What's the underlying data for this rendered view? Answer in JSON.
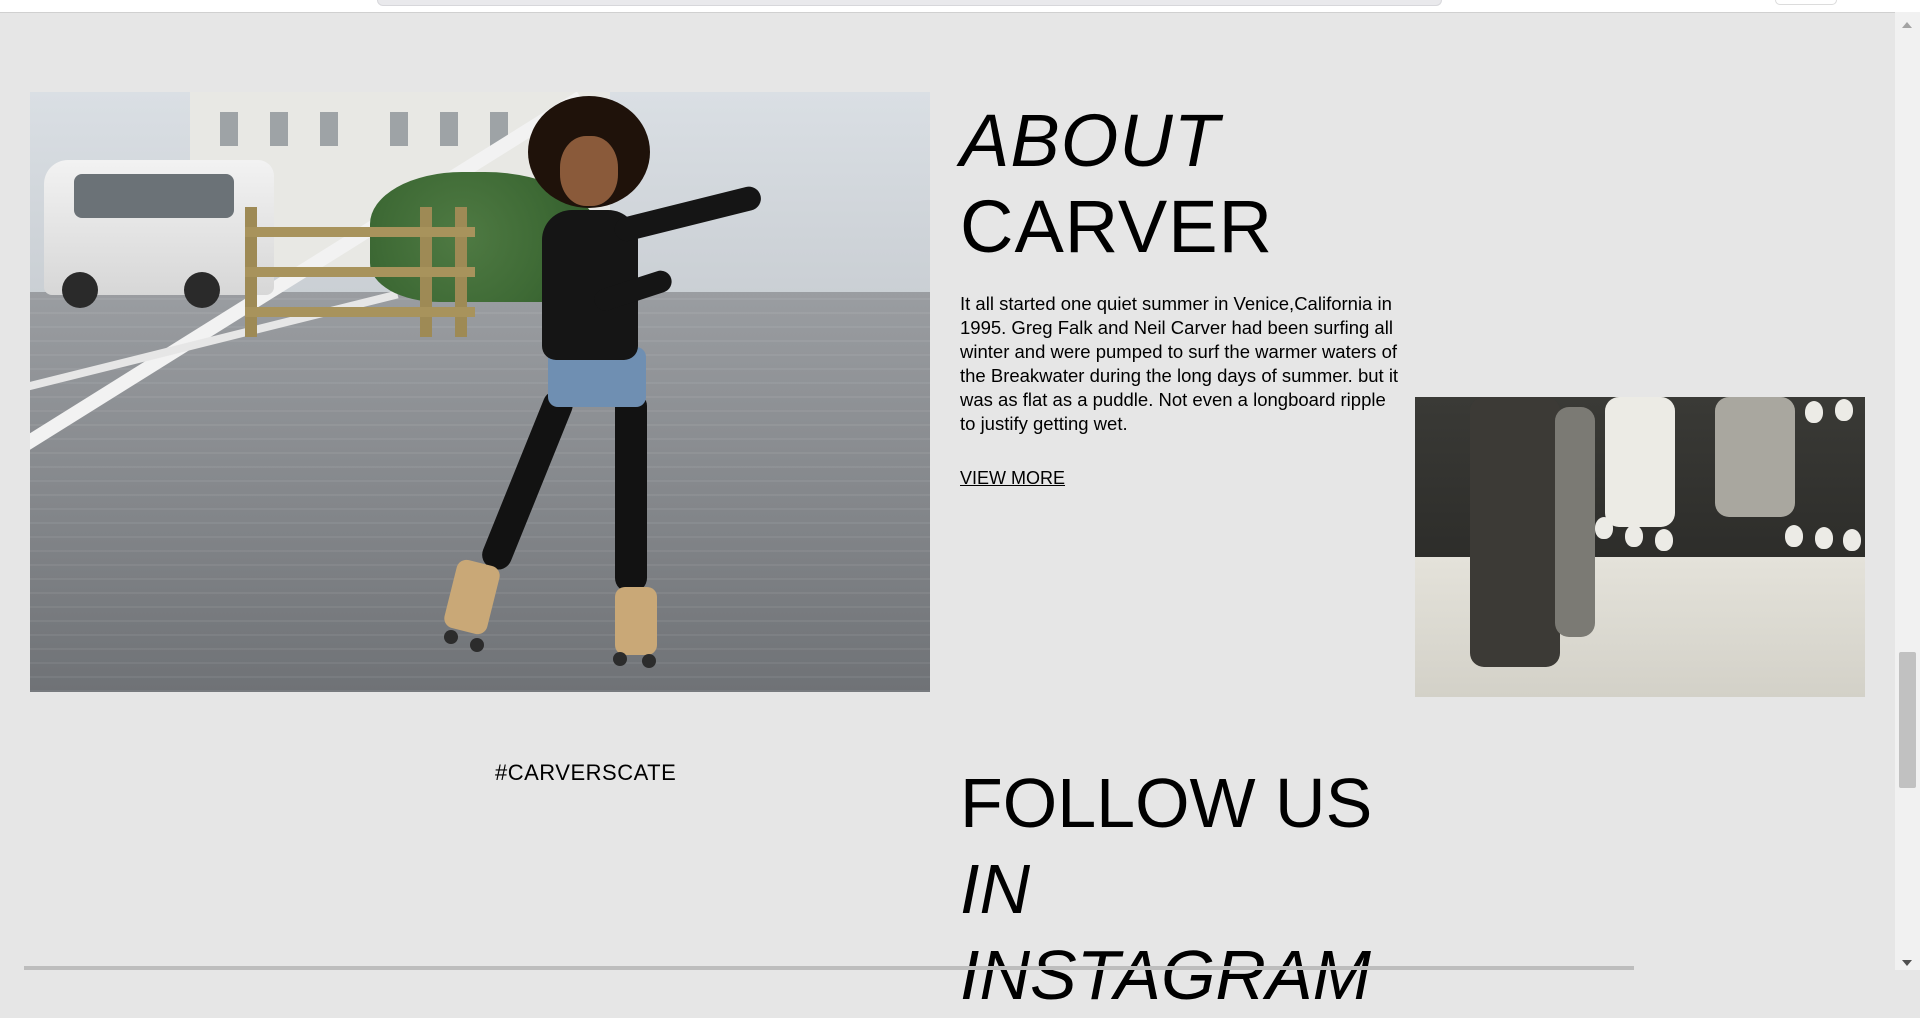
{
  "about": {
    "title_line1": "ABOUT",
    "title_line2": "CARVER",
    "body": "It all started one quiet summer in Venice,California in 1995. Greg Falk and Neil Carver had been surfing all winter and were pumped to surf the warmer waters of the Breakwater during the long days of summer. but it was as flat as a puddle. Not even a longboard ripple to justify getting wet.",
    "view_more": "VIEW MORE"
  },
  "hashtag": "#CARVERSCATE",
  "follow": {
    "line1": "FOLLOW US",
    "line2": "IN",
    "line3": "INSTAGRAM"
  },
  "colors": {
    "page_background": "#e6e6e6",
    "text": "#000000"
  },
  "icons": {
    "scroll_up": "triangle-up",
    "scroll_down": "triangle-down"
  },
  "scroll": {
    "position_fraction": 0.68
  }
}
